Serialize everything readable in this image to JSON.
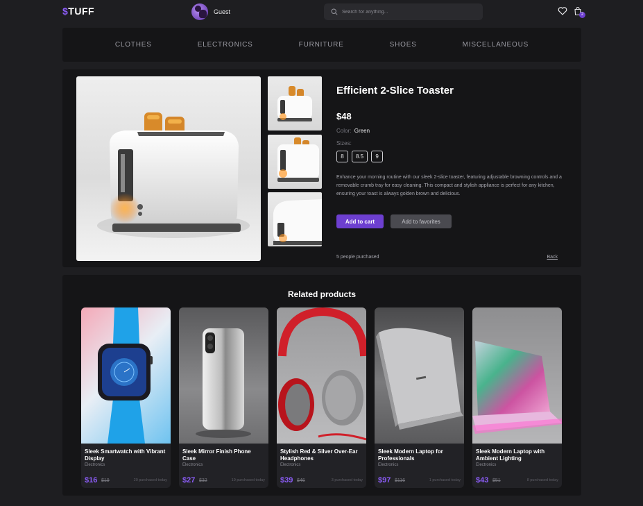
{
  "brand": {
    "dollar": "$",
    "name": "TUFF"
  },
  "header": {
    "user_name": "Guest",
    "search_placeholder": "Search for anything...",
    "cart_count": "2"
  },
  "categories": [
    "CLOTHES",
    "ELECTRONICS",
    "FURNITURE",
    "SHOES",
    "MISCELLANEOUS"
  ],
  "product": {
    "title": "Efficient 2-Slice Toaster",
    "price": "$48",
    "color_label": "Color:",
    "color_value": "Green",
    "sizes_label": "Sizes:",
    "sizes": [
      "8",
      "8.5",
      "9"
    ],
    "description": "Enhance your morning routine with our sleek 2-slice toaster, featuring adjustable browning controls and a removable crumb tray for easy cleaning. This compact and stylish appliance is perfect for any kitchen, ensuring your toast is always golden brown and delicious.",
    "add_to_cart": "Add to cart",
    "add_to_favorites": "Add to favorites",
    "purchased": "5 people purchased",
    "back": "Back"
  },
  "related": {
    "title": "Related products",
    "items": [
      {
        "name": "Sleek Smartwatch with Vibrant Display",
        "category": "Electronics",
        "price": "$16",
        "old_price": "$19",
        "sold": "20 purchased today"
      },
      {
        "name": "Sleek Mirror Finish Phone Case",
        "category": "Electronics",
        "price": "$27",
        "old_price": "$32",
        "sold": "19 purchased today"
      },
      {
        "name": "Stylish Red & Silver Over-Ear Headphones",
        "category": "Electronics",
        "price": "$39",
        "old_price": "$46",
        "sold": "3 purchased today"
      },
      {
        "name": "Sleek Modern Laptop for Professionals",
        "category": "Electronics",
        "price": "$97",
        "old_price": "$116",
        "sold": "1 purchased today"
      },
      {
        "name": "Sleek Modern Laptop with Ambient Lighting",
        "category": "Electronics",
        "price": "$43",
        "old_price": "$51",
        "sold": "8 purchased today"
      }
    ]
  },
  "colors": {
    "accent": "#6d3fd0",
    "price_accent": "#8b5cf6",
    "background": "#1e1e21",
    "panel": "#151517"
  }
}
